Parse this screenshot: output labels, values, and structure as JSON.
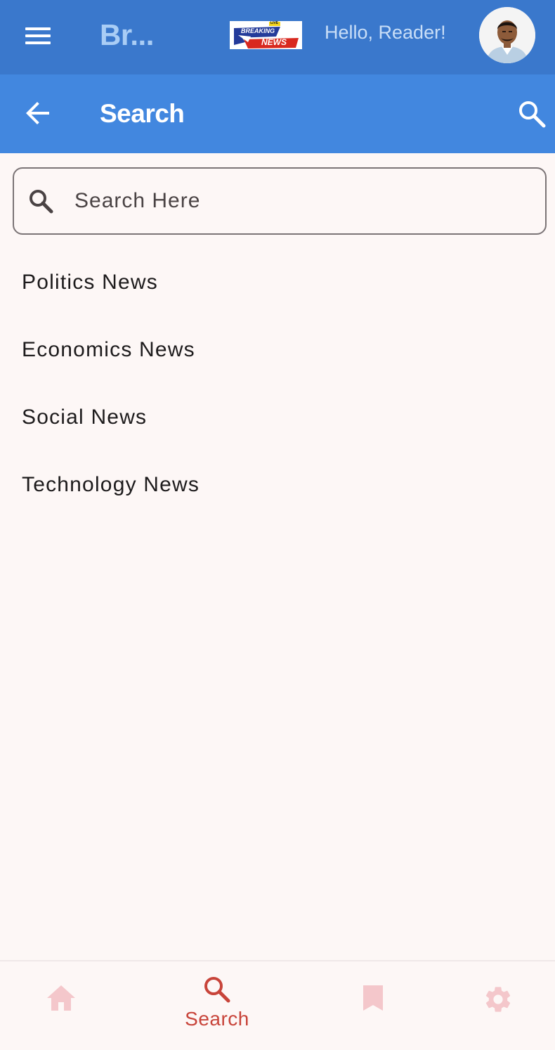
{
  "header": {
    "menu_icon": "hamburger-menu-icon",
    "app_title": "Br...",
    "logo": {
      "top_text": "LIVE",
      "line1": "BREAKING",
      "line2": "NEWS"
    },
    "greeting": "Hello, Reader!"
  },
  "app_bar": {
    "back_icon": "arrow-back-icon",
    "title": "Search",
    "search_icon": "search-icon"
  },
  "search": {
    "placeholder": "Search Here",
    "value": ""
  },
  "categories": [
    {
      "label": "Politics News"
    },
    {
      "label": "Economics News"
    },
    {
      "label": "Social News"
    },
    {
      "label": "Technology News"
    }
  ],
  "bottom_nav": {
    "items": [
      {
        "icon": "home-icon",
        "label": "",
        "active": false
      },
      {
        "icon": "search-icon",
        "label": "Search",
        "active": true
      },
      {
        "icon": "bookmark-icon",
        "label": "",
        "active": false
      },
      {
        "icon": "gear-icon",
        "label": "",
        "active": false
      }
    ]
  },
  "colors": {
    "header_bg": "#3a78cc",
    "app_bar_bg": "#4287df",
    "page_bg": "#fdf7f6",
    "nav_active": "#c8443a",
    "nav_inactive": "#f4c7cb"
  }
}
